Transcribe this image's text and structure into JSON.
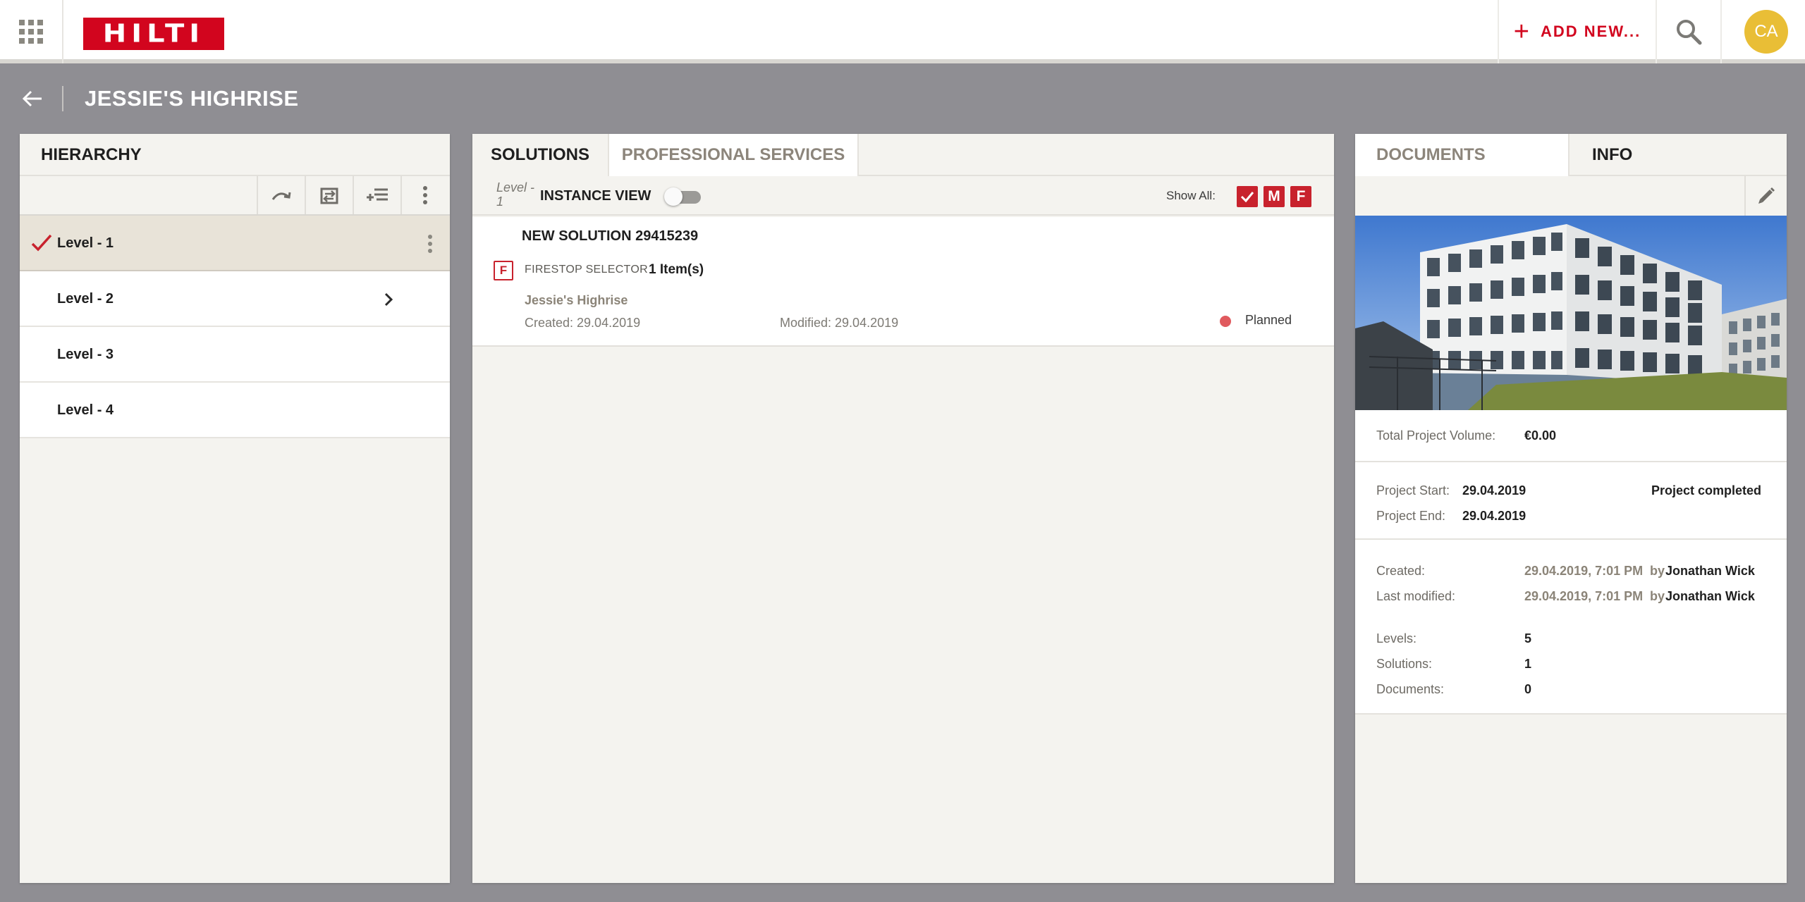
{
  "header": {
    "logo_text": "HILTI",
    "add_new_label": "ADD NEW...",
    "avatar_initials": "CA",
    "brand_color": "#d2051e"
  },
  "titlebar": {
    "title": "JESSIE'S HIGHRISE"
  },
  "hierarchy": {
    "title": "HIERARCHY",
    "levels": [
      {
        "label": "Level - 1",
        "active": true
      },
      {
        "label": "Level - 2",
        "active": false
      },
      {
        "label": "Level - 3",
        "active": false
      },
      {
        "label": "Level - 4",
        "active": false
      }
    ]
  },
  "solutions": {
    "tabs": [
      "SOLUTIONS",
      "PROFESSIONAL SERVICES"
    ],
    "current_level": "Level - 1",
    "instance_view_label": "INSTANCE VIEW",
    "instance_view_on": false,
    "show_all_label": "Show All:",
    "filters": [
      "M",
      "F"
    ],
    "items": [
      {
        "title": "NEW SOLUTION 29415239",
        "type_badge": "F",
        "type": "FIRESTOP SELECTOR",
        "count": "1 Item(s)",
        "project": "Jessie's Highrise",
        "created": "Created: 29.04.2019",
        "modified": "Modified: 29.04.2019",
        "status": "Planned",
        "status_color": "#e05a5e"
      }
    ]
  },
  "details": {
    "tabs": [
      "DOCUMENTS",
      "INFO"
    ],
    "total_volume_label": "Total Project Volume:",
    "total_volume": "€0.00",
    "project_start_label": "Project Start:",
    "project_start": "29.04.2019",
    "project_end_label": "Project End:",
    "project_end": "29.04.2019",
    "project_status": "Project completed",
    "created_label": "Created:",
    "created_date": "29.04.2019, 7:01 PM",
    "created_by_word": "by",
    "created_by": "Jonathan Wick",
    "modified_label": "Last modified:",
    "modified_date": "29.04.2019, 7:01 PM",
    "modified_by_word": "by",
    "modified_by": "Jonathan Wick",
    "levels_label": "Levels:",
    "levels_count": "5",
    "solutions_label": "Solutions:",
    "solutions_count": "1",
    "documents_label": "Documents:",
    "documents_count": "0"
  }
}
